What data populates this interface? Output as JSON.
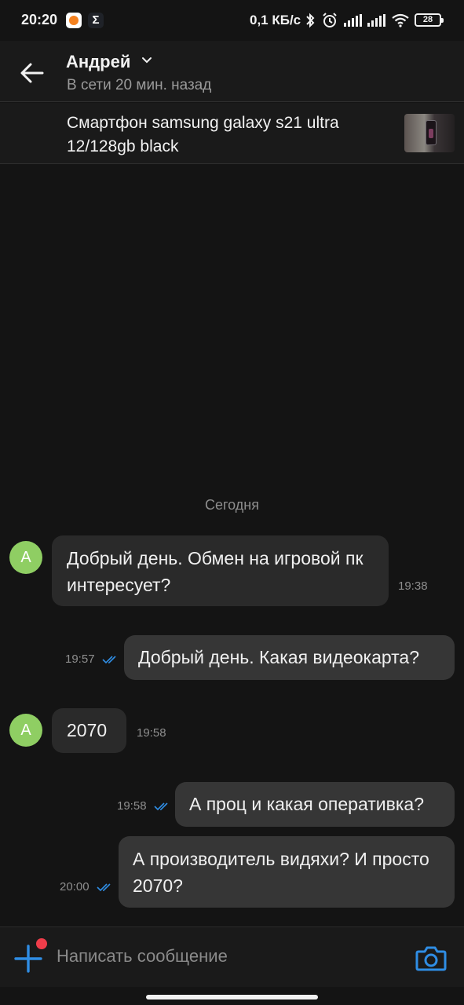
{
  "status_bar": {
    "time": "20:20",
    "app_icon_2": "Σ",
    "net_speed": "0,1 КБ/с",
    "battery": "28",
    "icons": [
      "notification-app-icon",
      "sigma-app-icon",
      "bluetooth-icon",
      "alarm-icon",
      "signal-icon",
      "signal-icon",
      "wifi-icon",
      "battery-icon"
    ]
  },
  "header": {
    "name": "Андрей",
    "status": "В сети 20 мин. назад"
  },
  "product": {
    "title": "Смартфон samsung galaxy s21 ultra 12/128gb black"
  },
  "chat": {
    "day_label": "Сегодня",
    "messages": [
      {
        "direction": "in",
        "avatar": "А",
        "text": "Добрый день. Обмен на игровой пк интересует?",
        "time": "19:38"
      },
      {
        "direction": "out",
        "text": "Добрый день. Какая видеокарта?",
        "time": "19:57",
        "read": true
      },
      {
        "direction": "in",
        "avatar": "А",
        "text": "2070",
        "time": "19:58"
      },
      {
        "direction": "out",
        "text": "А проц и какая оперативка?",
        "time": "19:58",
        "read": true
      },
      {
        "direction": "out",
        "text": "А производитель видяхи?  И просто 2070?",
        "time": "20:00",
        "read": true
      }
    ]
  },
  "composer": {
    "placeholder": "Написать сообщение"
  },
  "colors": {
    "background": "#141414",
    "bar": "#1a1a1a",
    "incoming_bubble": "#2a2a2a",
    "outgoing_bubble": "#363636",
    "avatar": "#8fce63",
    "accent": "#2f8de4",
    "badge": "#ef3d4a"
  }
}
